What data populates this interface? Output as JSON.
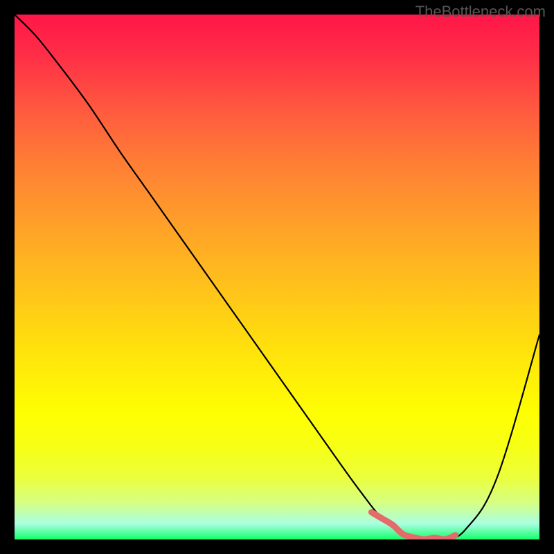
{
  "watermark": "TheBottleneck.com",
  "chart_data": {
    "type": "line",
    "title": "",
    "xlabel": "",
    "ylabel": "",
    "xlim": [
      0,
      100
    ],
    "ylim": [
      0,
      100
    ],
    "curve": {
      "x": [
        0,
        4,
        8,
        14,
        20,
        26,
        32,
        38,
        44,
        50,
        56,
        62,
        66,
        70,
        74,
        78,
        82,
        86,
        92,
        100
      ],
      "y": [
        100,
        96,
        91,
        83,
        74,
        65.5,
        57,
        48.5,
        40,
        31.5,
        23,
        14.5,
        9,
        4,
        1,
        0,
        0,
        2,
        12,
        39
      ]
    },
    "highlight_segment": {
      "x": [
        68,
        70,
        72,
        74,
        76,
        78,
        80,
        82,
        84
      ],
      "y": [
        5.2,
        4.0,
        2.8,
        1.0,
        0.4,
        0.0,
        0.3,
        0.0,
        0.8
      ]
    },
    "gradient_colors": {
      "top": "#ff1648",
      "mid_upper": "#ff7d35",
      "mid": "#ffe20c",
      "mid_lower": "#ecff3a",
      "bottom": "#13ff6a"
    }
  }
}
